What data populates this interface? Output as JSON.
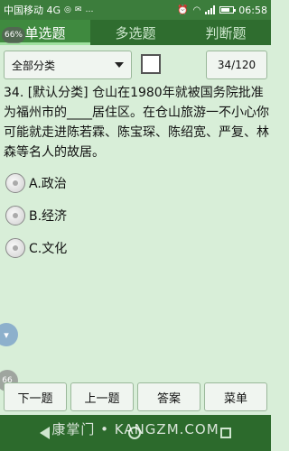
{
  "statusbar": {
    "carrier": "中国移动 4G",
    "mini": "…",
    "time": "06:58"
  },
  "tabs": [
    {
      "label": "单选题",
      "active": true
    },
    {
      "label": "多选题",
      "active": false
    },
    {
      "label": "判断题",
      "active": false
    }
  ],
  "overlay_badge": "66%",
  "filter": {
    "category": "全部分类",
    "counter": "34/120"
  },
  "question": {
    "text": "34. [默认分类] 仓山在1980年就被国务院批准为福州市的____居住区。在仓山旅游一不小心你可能就走进陈若霖、陈宝琛、陈绍宽、严复、林森等名人的故居。"
  },
  "options": [
    {
      "label": "A.政治"
    },
    {
      "label": "B.经济"
    },
    {
      "label": "C.文化"
    }
  ],
  "float_badge": "66",
  "buttons": {
    "next": "下一题",
    "prev": "上一题",
    "answer": "答案",
    "menu": "菜单"
  },
  "watermark": "康掌门 • KANGZM.COM",
  "colors": {
    "background": "#d8eed8",
    "tabbar": "#2f6d2f",
    "statusbar": "#3c7d3c",
    "navbar": "#2c6a2c"
  },
  "icons": {
    "status_left": [
      "notification-icon",
      "mail-icon"
    ],
    "status_right": [
      "alarm-icon",
      "wifi-icon",
      "signal-icon",
      "battery-icon"
    ],
    "nav": [
      "back-icon",
      "home-icon",
      "recent-apps-icon"
    ]
  }
}
